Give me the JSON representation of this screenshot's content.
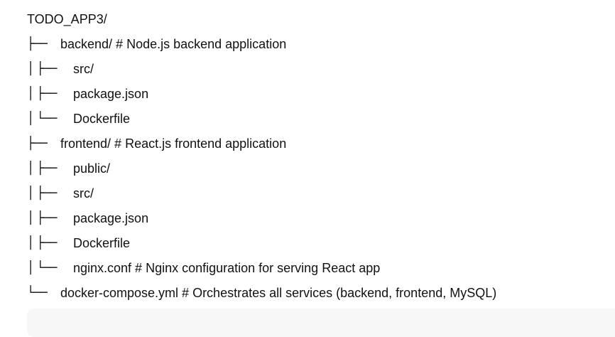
{
  "tree": {
    "root": "TODO_APP3/",
    "lines": [
      {
        "prefix": "├── ",
        "text": "backend/ # Node.js backend application",
        "level": 1
      },
      {
        "prefix": "│ ├── ",
        "text": "src/",
        "level": 2
      },
      {
        "prefix": "│ ├── ",
        "text": "package.json",
        "level": 2
      },
      {
        "prefix": "│ └── ",
        "text": "Dockerfile",
        "level": 2
      },
      {
        "prefix": "├── ",
        "text": "frontend/ # React.js frontend application",
        "level": 1
      },
      {
        "prefix": "│ ├── ",
        "text": "public/",
        "level": 2
      },
      {
        "prefix": "│ ├── ",
        "text": "src/",
        "level": 2
      },
      {
        "prefix": "│ ├── ",
        "text": "package.json",
        "level": 2
      },
      {
        "prefix": "│ ├── ",
        "text": "Dockerfile",
        "level": 2
      },
      {
        "prefix": "│ └── ",
        "text": "nginx.conf # Nginx configuration for serving React app",
        "level": 2
      },
      {
        "prefix": "└── ",
        "text": "docker-compose.yml # Orchestrates all services (backend, frontend, MySQL)",
        "level": 1
      }
    ]
  }
}
